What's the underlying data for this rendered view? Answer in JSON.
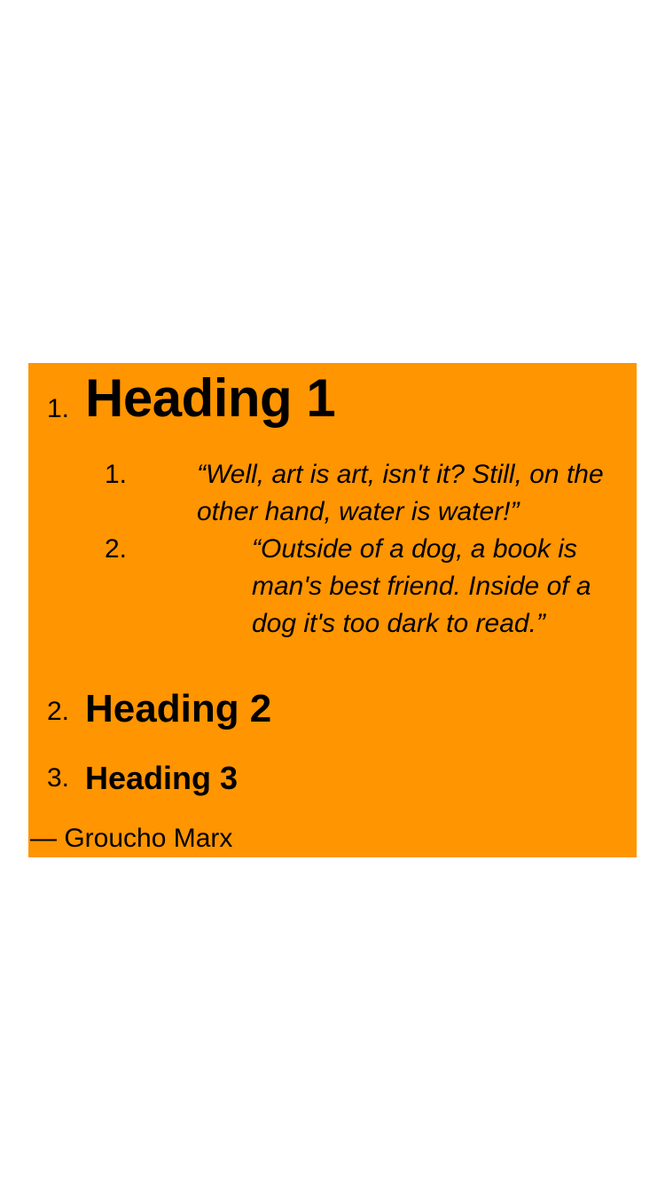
{
  "colors": {
    "panel_background": "#ff9500",
    "page_background": "#ffffff",
    "text": "#000000"
  },
  "list": {
    "items": [
      {
        "marker": "1.",
        "heading": "Heading 1",
        "sub_items": [
          {
            "marker": "1.",
            "text": "“Well, art is art, isn't it? Still, on the other hand, water is water!”"
          },
          {
            "marker": "2.",
            "text": "“Outside of a dog, a book is man's best friend. Inside of a dog it's too dark to read.”"
          }
        ]
      },
      {
        "marker": "2.",
        "heading": "Heading 2"
      },
      {
        "marker": "3.",
        "heading": "Heading 3"
      }
    ]
  },
  "attribution": "— Groucho Marx"
}
